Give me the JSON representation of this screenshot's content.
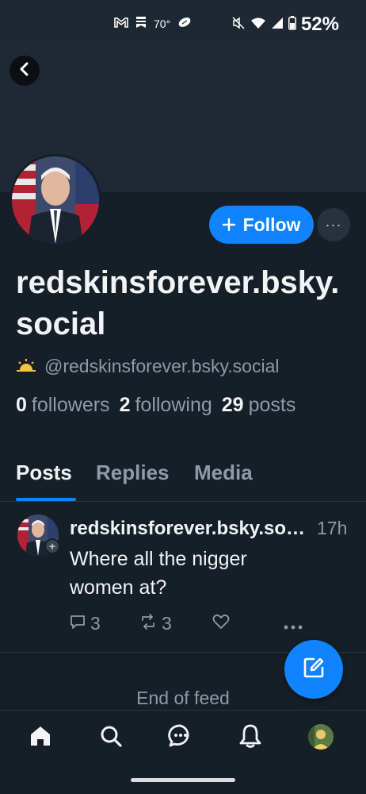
{
  "status_bar": {
    "temperature": "70°",
    "battery": "52%",
    "icons": [
      "gmail-icon",
      "bookmark-icon",
      "football-icon",
      "mute-icon",
      "wifi-icon",
      "signal-icon",
      "battery-icon"
    ]
  },
  "profile": {
    "display_name": "redskinsforever.bsky.social",
    "handle": "@redskinsforever.bsky.social",
    "follow_label": "Follow",
    "more_label": "···",
    "stats": {
      "followers_count": "0",
      "followers_label": "followers",
      "following_count": "2",
      "following_label": "following",
      "posts_count": "29",
      "posts_label": "posts"
    }
  },
  "tabs": [
    {
      "label": "Posts",
      "active": true
    },
    {
      "label": "Replies",
      "active": false
    },
    {
      "label": "Media",
      "active": false
    }
  ],
  "posts": [
    {
      "author": "redskinsforever.bsky.social",
      "time": "17h",
      "text": "Where all the nigger women at?",
      "reply_count": "3",
      "repost_count": "3"
    }
  ],
  "feed": {
    "end_label": "End of feed"
  },
  "bottom_nav": [
    "home-icon",
    "search-icon",
    "chat-icon",
    "notifications-icon",
    "profile-avatar"
  ],
  "colors": {
    "accent": "#1083fe",
    "background": "#161e27",
    "muted_text": "#8e9aa7"
  }
}
